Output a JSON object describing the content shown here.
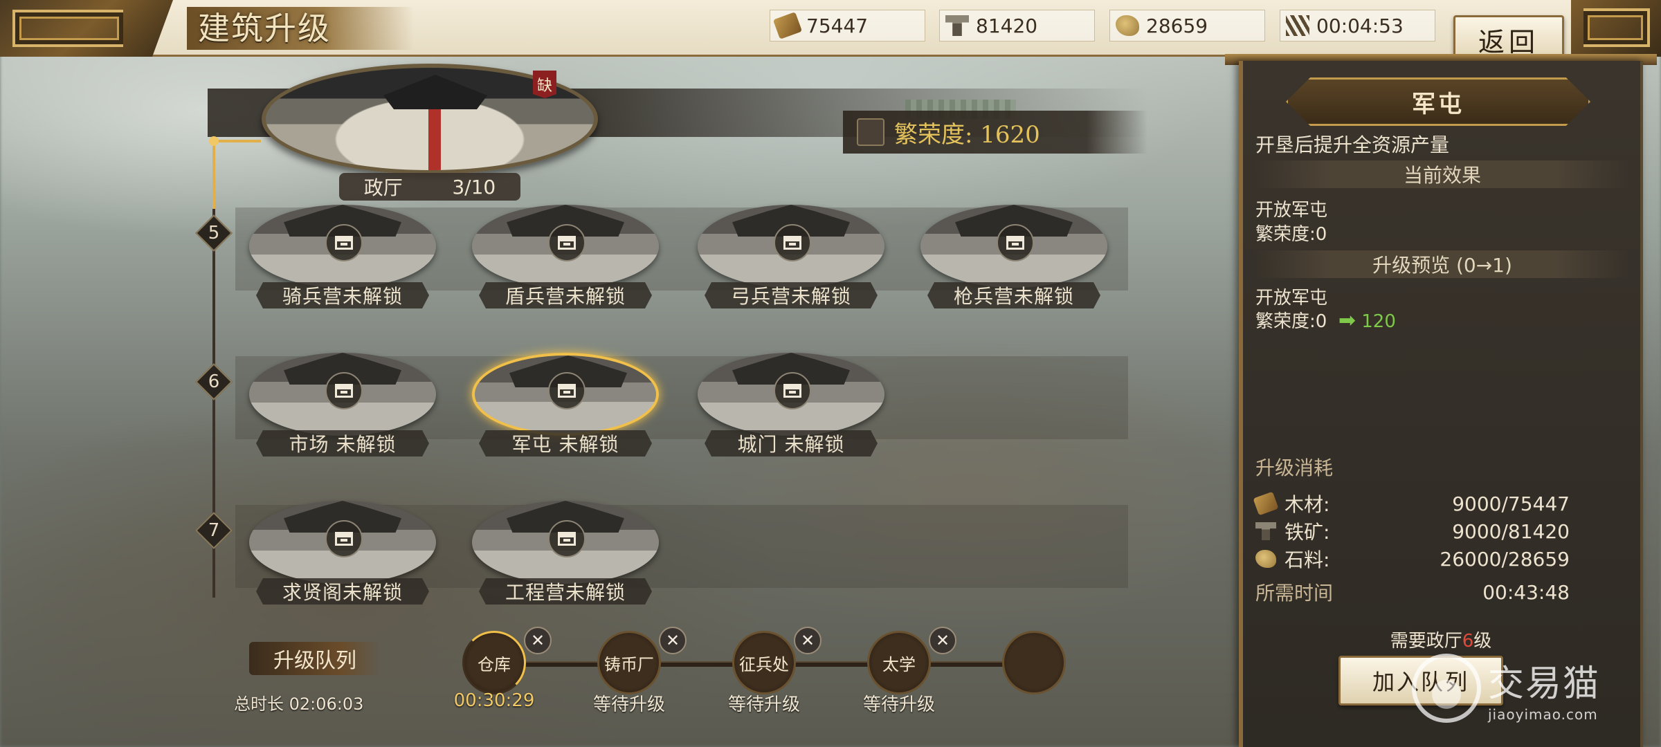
{
  "header": {
    "title": "建筑升级",
    "back_label": "返回"
  },
  "resources": [
    {
      "icon": "wood-icon",
      "value": "75447"
    },
    {
      "icon": "iron-icon",
      "value": "81420"
    },
    {
      "icon": "stone-icon",
      "value": "28659"
    },
    {
      "icon": "hourglass-icon",
      "value": "00:04:53"
    }
  ],
  "hall": {
    "name": "政厅",
    "level": "3/10",
    "flag": "缺",
    "prosperity": "繁荣度: 1620"
  },
  "levels": [
    "5",
    "6",
    "7"
  ],
  "buildings": {
    "row5": [
      {
        "name": "骑兵营未解锁"
      },
      {
        "name": "盾兵营未解锁"
      },
      {
        "name": "弓兵营未解锁"
      },
      {
        "name": "枪兵营未解锁"
      }
    ],
    "row6": [
      {
        "name": "市场  未解锁"
      },
      {
        "name": "军屯  未解锁"
      },
      {
        "name": "城门  未解锁"
      }
    ],
    "row7": [
      {
        "name": "求贤阁未解锁"
      },
      {
        "name": "工程营未解锁"
      }
    ]
  },
  "queue": {
    "title": "升级队列",
    "total": "总时长  02:06:03",
    "items": [
      {
        "name": "仓库",
        "status": "00:30:29"
      },
      {
        "name": "铸币厂",
        "status": "等待升级"
      },
      {
        "name": "征兵处",
        "status": "等待升级"
      },
      {
        "name": "太学",
        "status": "等待升级"
      }
    ]
  },
  "panel": {
    "name": "军屯",
    "desc": "开垦后提升全资源产量",
    "current_head": "当前效果",
    "current_line1": "开放军屯",
    "current_line2": "繁荣度:0",
    "preview_head": "升级预览 (0→1)",
    "preview_line1": "开放军屯",
    "preview_line2": "繁荣度:0",
    "preview_arrow": "➡",
    "preview_value": "120",
    "cost_head": "升级消耗",
    "costs": [
      {
        "icon": "wood-icon",
        "label": "木材:",
        "value": "9000/75447"
      },
      {
        "icon": "iron-icon",
        "label": "铁矿:",
        "value": "9000/81420"
      },
      {
        "icon": "stone-icon",
        "label": "石料:",
        "value": "26000/28659"
      }
    ],
    "time_label": "所需时间",
    "time_value": "00:43:48",
    "need_prefix": "需要政厅",
    "need_level": "6",
    "need_suffix": "级",
    "join_label": "加入队列"
  },
  "watermark": {
    "cn": "交易猫",
    "en": "jiaoyimao.com"
  }
}
